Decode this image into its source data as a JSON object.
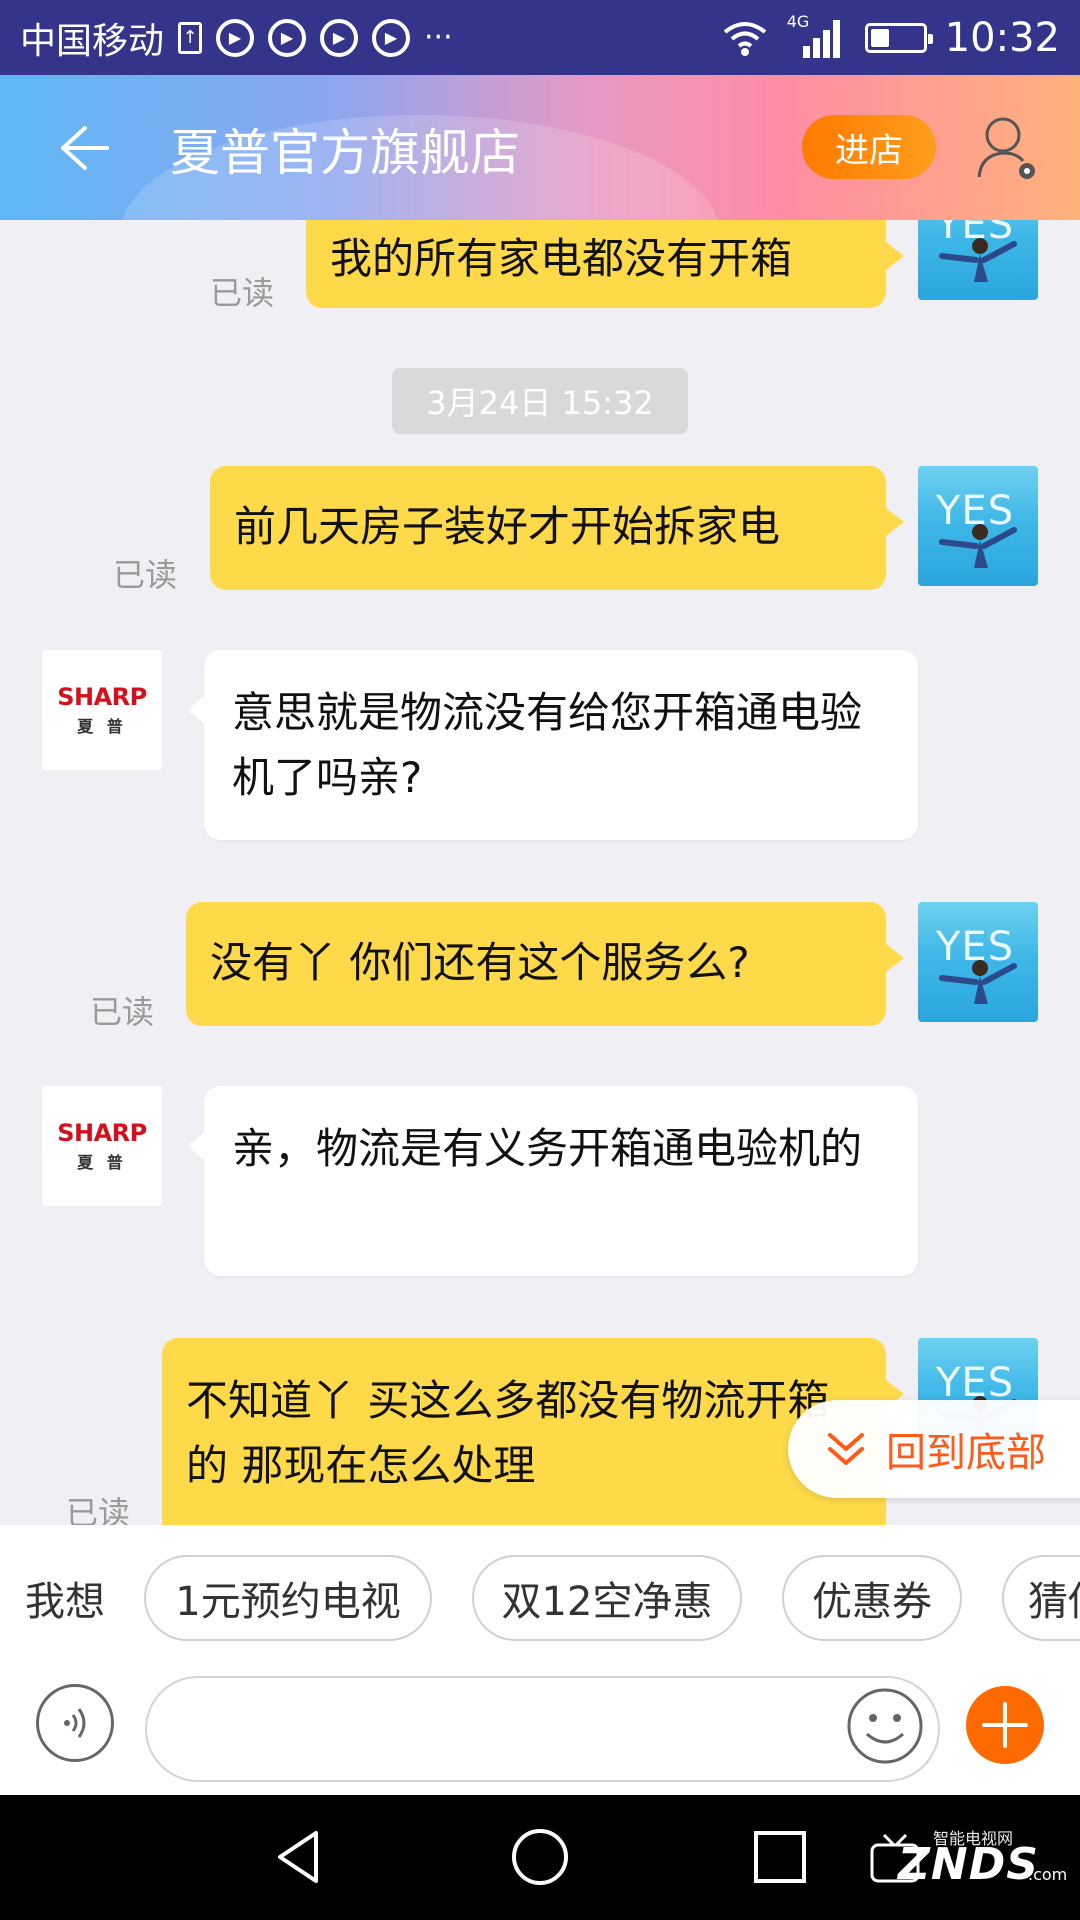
{
  "status_bar": {
    "carrier": "中国移动",
    "network": "4G",
    "time": "10:32",
    "battery_level": 0.35
  },
  "header": {
    "title": "夏普官方旗舰店",
    "enter_store": "进店"
  },
  "chat": {
    "timestamp": "3月24日 15:32",
    "read_label": "已读",
    "avatar_me_text": "YES",
    "sharp_logo": "SHARP",
    "sharp_cn": "夏 普",
    "messages": [
      {
        "from": "me",
        "text": "我的所有家电都没有开箱",
        "read": true
      },
      {
        "from": "me",
        "text": "前几天房子装好才开始拆家电",
        "read": true
      },
      {
        "from": "them",
        "text": "意思就是物流没有给您开箱通电验机了吗亲?"
      },
      {
        "from": "me",
        "text": "没有丫 你们还有这个服务么?",
        "read": true
      },
      {
        "from": "them",
        "text": "亲，物流是有义务开箱通电验机的"
      },
      {
        "from": "me",
        "text": "不知道丫 买这么多都没有物流开箱的 那现在怎么处理",
        "read": true
      }
    ],
    "back_to_bottom": "回到底部"
  },
  "quick_replies": {
    "label": "我想",
    "chips": [
      "1元预约电视",
      "双12空净惠",
      "优惠券",
      "猜你"
    ]
  },
  "input": {
    "placeholder": ""
  },
  "watermark": {
    "top": "智能电视网",
    "main": "ZNDS",
    "suffix": ".com"
  },
  "colors": {
    "my_bubble": "#fed94a",
    "accent_orange": "#ff6a00",
    "status_bar": "#34358a"
  }
}
